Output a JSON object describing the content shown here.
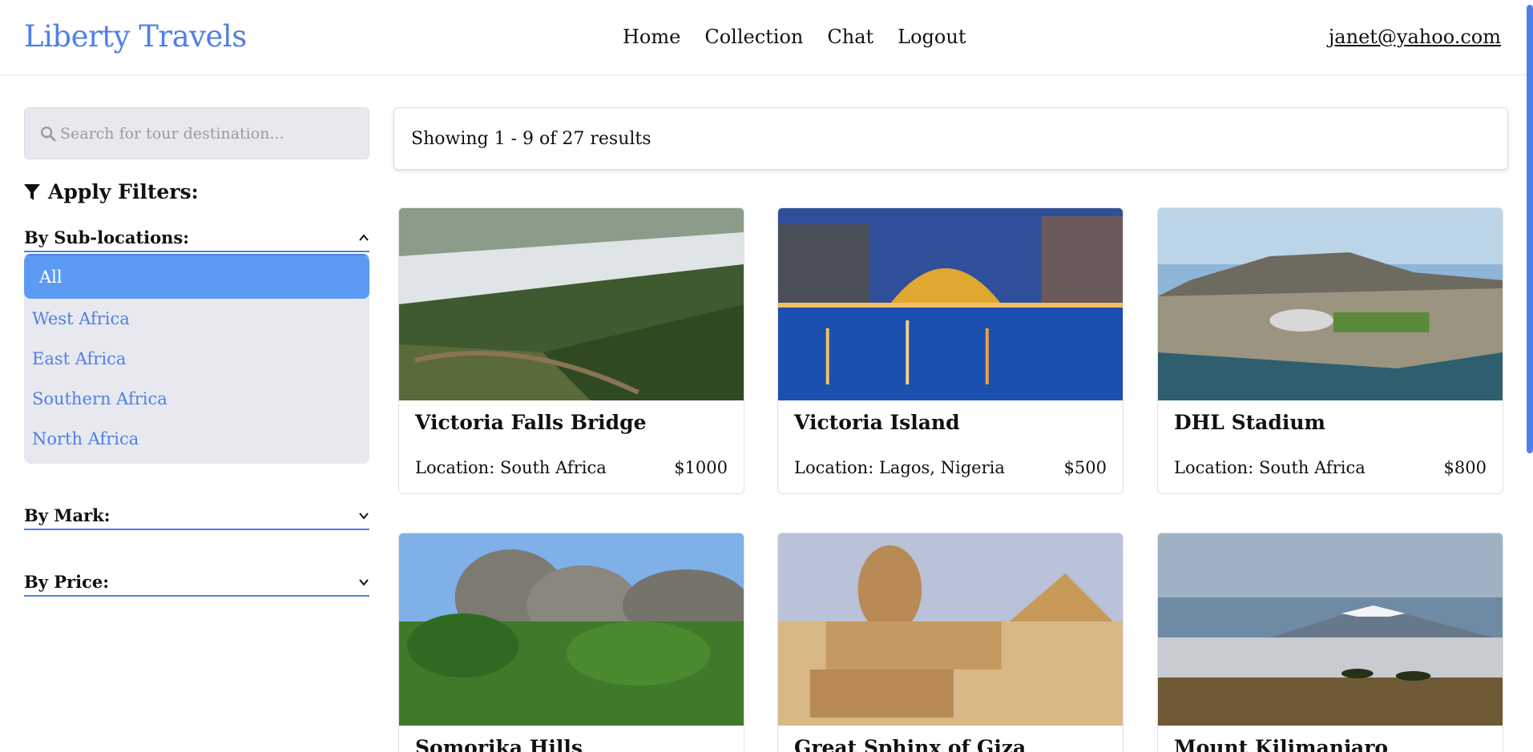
{
  "header": {
    "brand": "Liberty Travels",
    "nav": [
      "Home",
      "Collection",
      "Chat",
      "Logout"
    ],
    "user_email": "janet@yahoo.com"
  },
  "sidebar": {
    "search_placeholder": "Search for tour destination...",
    "filters_title": "Apply Filters:",
    "sub_locations": {
      "label": "By Sub-locations:",
      "expanded": true,
      "items": [
        "All",
        "West Africa",
        "East Africa",
        "Southern Africa",
        "North Africa"
      ],
      "selected": "All"
    },
    "mark": {
      "label": "By Mark:",
      "expanded": false
    },
    "price": {
      "label": "By Price:",
      "expanded": false
    }
  },
  "results": {
    "text": "Showing 1 - 9 of 27 results"
  },
  "tours": [
    {
      "title": "Victoria Falls Bridge",
      "location": "Location: South Africa",
      "price": "$1000"
    },
    {
      "title": "Victoria Island",
      "location": "Location: Lagos, Nigeria",
      "price": "$500"
    },
    {
      "title": "DHL Stadium",
      "location": "Location: South Africa",
      "price": "$800"
    },
    {
      "title": "Somorika Hills",
      "location": "",
      "price": ""
    },
    {
      "title": "Great Sphinx of Giza",
      "location": "",
      "price": ""
    },
    {
      "title": "Mount Kilimanjaro",
      "location": "",
      "price": ""
    }
  ],
  "colors": {
    "accent": "#4f7fe8",
    "selected_bg": "#5b9bf4",
    "sidebar_bg": "#e8e9ee"
  }
}
